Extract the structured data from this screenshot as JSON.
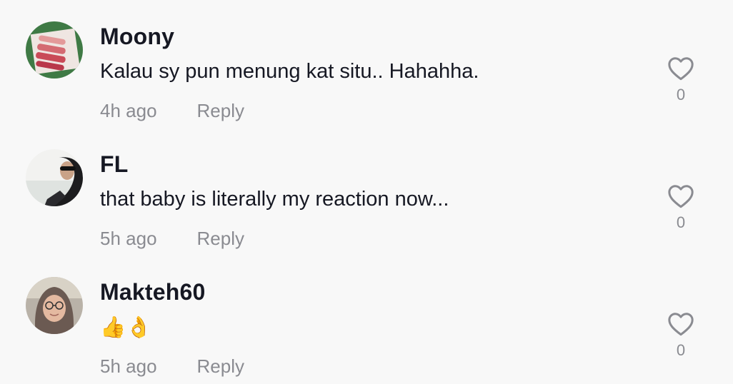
{
  "comments": [
    {
      "username": "Moony",
      "text": "Kalau sy pun menung kat situ.. Hahahha.",
      "time": "4h ago",
      "reply_label": "Reply",
      "likes": "0",
      "avatar": "lipstick-swatch-avatar"
    },
    {
      "username": "FL",
      "text": "that baby is literally my reaction now...",
      "time": "5h ago",
      "reply_label": "Reply",
      "likes": "0",
      "avatar": "hijab-sunglasses-avatar"
    },
    {
      "username": "Makteh60",
      "text": "👍👌",
      "time": "5h ago",
      "reply_label": "Reply",
      "likes": "0",
      "avatar": "hijab-glasses-avatar"
    }
  ],
  "icons": {
    "like": "heart-outline-icon"
  },
  "colors": {
    "background": "#f8f8f8",
    "username": "#161823",
    "meta": "#8a8b91"
  }
}
